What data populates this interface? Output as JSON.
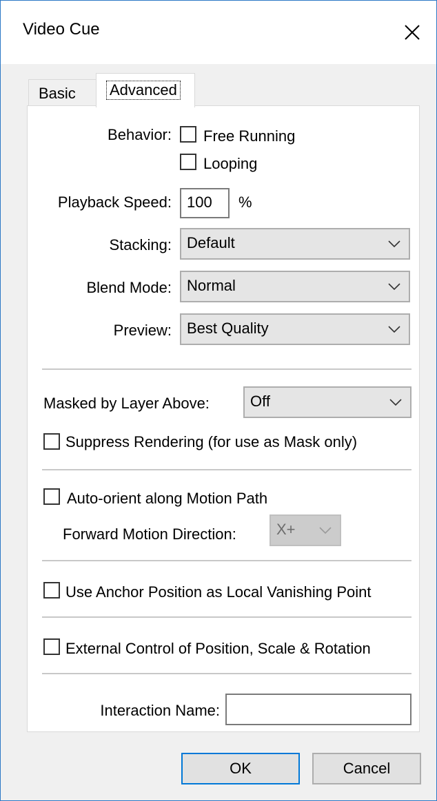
{
  "window": {
    "title": "Video Cue"
  },
  "tabs": [
    {
      "label": "Basic"
    },
    {
      "label": "Advanced"
    }
  ],
  "behavior": {
    "label": "Behavior:",
    "free_running": "Free Running",
    "looping": "Looping"
  },
  "playback": {
    "label": "Playback Speed:",
    "value": "100",
    "unit": "%"
  },
  "stacking": {
    "label": "Stacking:",
    "value": "Default"
  },
  "blend": {
    "label": "Blend Mode:",
    "value": "Normal"
  },
  "preview": {
    "label": "Preview:",
    "value": "Best Quality"
  },
  "masked": {
    "label": "Masked by Layer Above:",
    "value": "Off"
  },
  "suppress": {
    "label": "Suppress Rendering (for use as Mask only)"
  },
  "auto_orient": {
    "label": "Auto-orient along Motion Path",
    "direction_label": "Forward Motion Direction:",
    "direction_value": "X+"
  },
  "anchor": {
    "label": "Use Anchor Position as Local Vanishing Point"
  },
  "external": {
    "label": "External Control of Position, Scale & Rotation"
  },
  "interaction": {
    "label": "Interaction Name:",
    "value": ""
  },
  "buttons": {
    "ok": "OK",
    "cancel": "Cancel"
  }
}
